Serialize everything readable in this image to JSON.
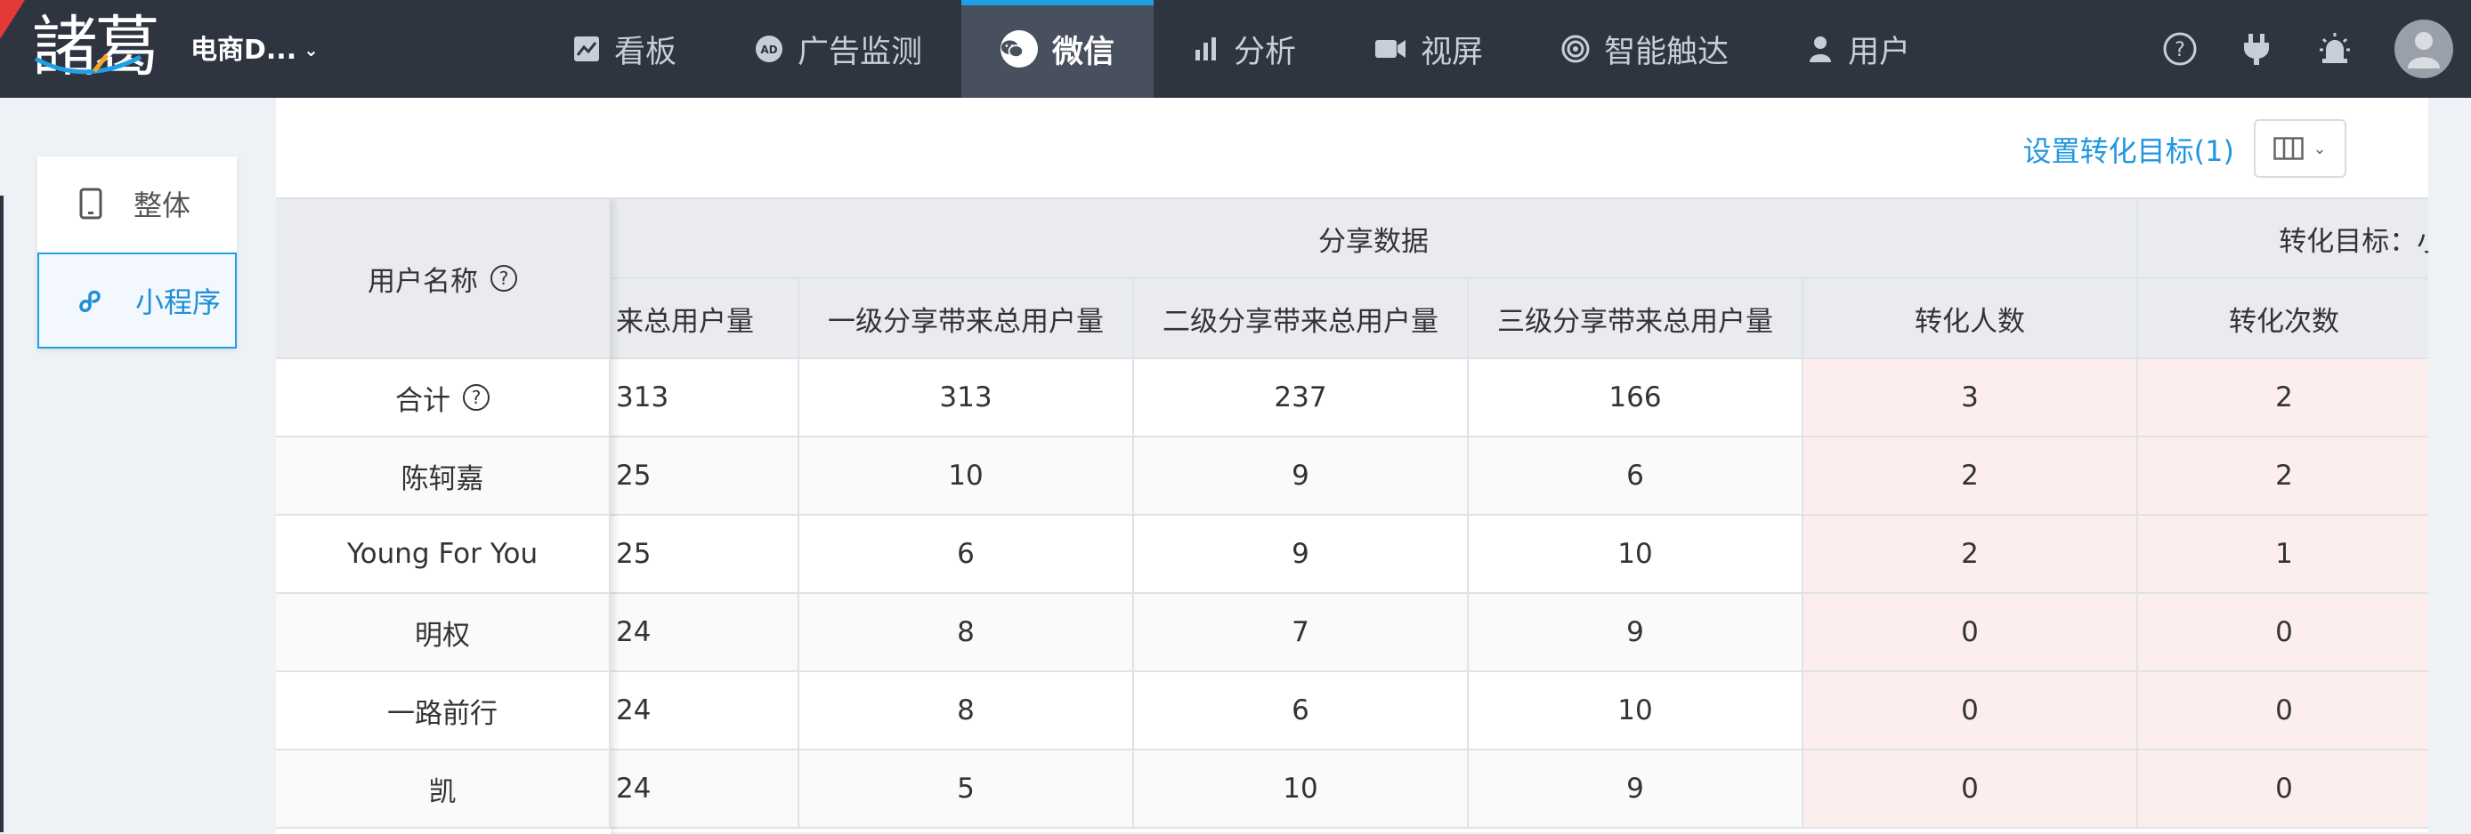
{
  "brand": {
    "logo_text": "諸葛",
    "project_name": "电商D...",
    "project_caret": "⌄"
  },
  "nav": {
    "items": [
      {
        "label": "看板",
        "icon": "chart-icon"
      },
      {
        "label": "广告监测",
        "icon": "ad-icon"
      },
      {
        "label": "微信",
        "icon": "wechat-icon",
        "active": true
      },
      {
        "label": "分析",
        "icon": "bar-chart-icon"
      },
      {
        "label": "视屏",
        "icon": "video-icon"
      },
      {
        "label": "智能触达",
        "icon": "target-icon"
      },
      {
        "label": "用户",
        "icon": "user-icon"
      }
    ],
    "right_icons": [
      "help-icon",
      "plug-icon",
      "alarm-icon",
      "avatar-icon"
    ]
  },
  "sidebar": {
    "items": [
      {
        "label": "整体",
        "icon": "phone-icon"
      },
      {
        "label": "小程序",
        "icon": "mini-program-icon",
        "active": true
      }
    ]
  },
  "toolbar": {
    "goal_link": "设置转化目标(1)",
    "columns_button_icon": "columns-icon"
  },
  "table": {
    "group_headers": {
      "share": "分享数据",
      "conversion": "转化目标：小程序–付款成功"
    },
    "user_col_header": "用户名称",
    "columns": [
      "来总用户量",
      "一级分享带来总用户量",
      "二级分享带来总用户量",
      "三级分享带来总用户量",
      "转化人数",
      "转化次数"
    ],
    "total_label": "合计",
    "total_row": [
      "313",
      "313",
      "237",
      "166",
      "3",
      "2"
    ],
    "rows": [
      {
        "name": "陈轲嘉",
        "values": [
          "25",
          "10",
          "9",
          "6",
          "2",
          "2"
        ]
      },
      {
        "name": "Young For You",
        "values": [
          "25",
          "6",
          "9",
          "10",
          "2",
          "1"
        ]
      },
      {
        "name": "明权",
        "values": [
          "24",
          "8",
          "7",
          "9",
          "0",
          "0"
        ]
      },
      {
        "name": "一路前行",
        "values": [
          "24",
          "8",
          "6",
          "10",
          "0",
          "0"
        ]
      },
      {
        "name": "凯",
        "values": [
          "24",
          "5",
          "10",
          "9",
          "0",
          "0"
        ]
      }
    ]
  },
  "colors": {
    "topbar": "#2e3440",
    "accent": "#1fa0e5",
    "conversion_bg": "#fdeeee"
  }
}
